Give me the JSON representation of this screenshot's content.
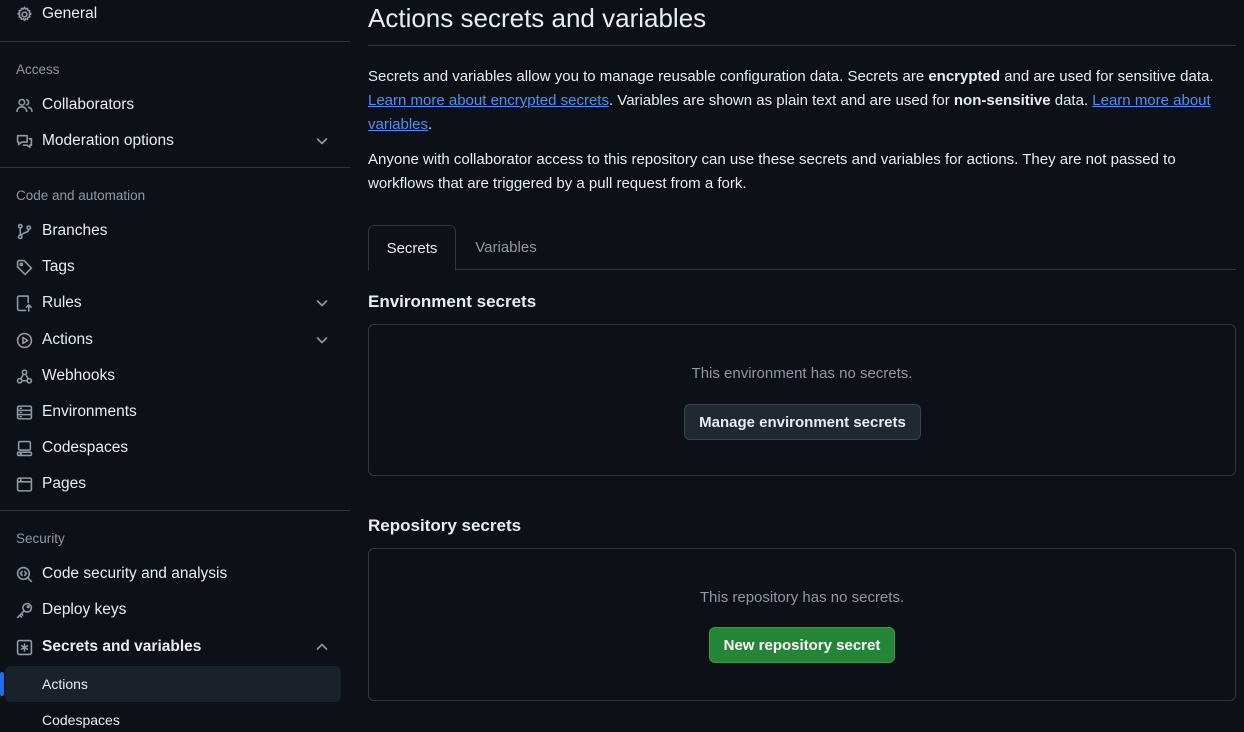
{
  "sidebar": {
    "general": "General",
    "access_head": "Access",
    "collaborators": "Collaborators",
    "moderation": "Moderation options",
    "code_head": "Code and automation",
    "branches": "Branches",
    "tags": "Tags",
    "rules": "Rules",
    "actions": "Actions",
    "webhooks": "Webhooks",
    "environments": "Environments",
    "codespaces": "Codespaces",
    "pages": "Pages",
    "security_head": "Security",
    "code_security": "Code security and analysis",
    "deploy_keys": "Deploy keys",
    "secrets_vars": "Secrets and variables",
    "sub_actions": "Actions",
    "sub_codespaces": "Codespaces"
  },
  "main": {
    "title": "Actions secrets and variables",
    "intro_1": "Secrets and variables allow you to manage reusable configuration data. Secrets are ",
    "intro_bold_1": "encrypted",
    "intro_2": " and are used for sensitive data. ",
    "link_secrets": "Learn more about encrypted secrets",
    "intro_3": ". Variables are shown as plain text and are used for ",
    "intro_bold_2": "non-sensitive",
    "intro_4": " data. ",
    "link_variables": "Learn more about variables",
    "intro_5": ".",
    "note": "Anyone with collaborator access to this repository can use these secrets and variables for actions. They are not passed to workflows that are triggered by a pull request from a fork.",
    "tabs": [
      "Secrets",
      "Variables"
    ],
    "env_heading": "Environment secrets",
    "env_empty": "This environment has no secrets.",
    "env_button": "Manage environment secrets",
    "repo_heading": "Repository secrets",
    "repo_empty": "This repository has no secrets.",
    "repo_button": "New repository secret"
  },
  "colors": {
    "background": "#0d1117",
    "border": "#30363d",
    "link": "#4493f8",
    "primary_button": "#238636",
    "active_indicator": "#1f6feb"
  }
}
